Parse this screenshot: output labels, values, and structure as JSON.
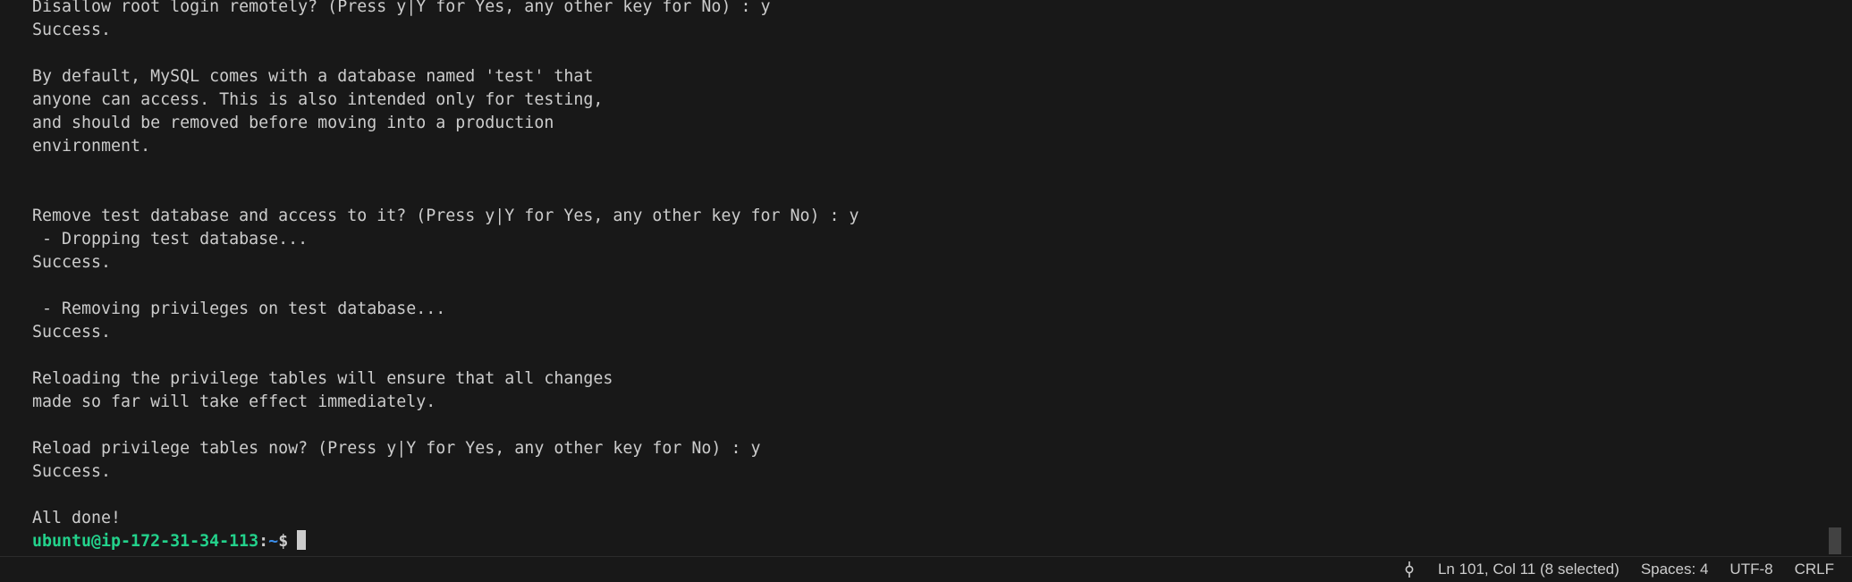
{
  "terminal": {
    "lines": [
      "Disallow root login remotely? (Press y|Y for Yes, any other key for No) : y",
      "Success.",
      "",
      "By default, MySQL comes with a database named 'test' that",
      "anyone can access. This is also intended only for testing,",
      "and should be removed before moving into a production",
      "environment.",
      "",
      "",
      "Remove test database and access to it? (Press y|Y for Yes, any other key for No) : y",
      " - Dropping test database...",
      "Success.",
      "",
      " - Removing privileges on test database...",
      "Success.",
      "",
      "Reloading the privilege tables will ensure that all changes",
      "made so far will take effect immediately.",
      "",
      "Reload privilege tables now? (Press y|Y for Yes, any other key for No) : y",
      "Success.",
      "",
      "All done!"
    ],
    "prompt": {
      "user_host": "ubuntu@ip-172-31-34-113",
      "separator": ":",
      "path": "~",
      "symbol": "$"
    }
  },
  "statusbar": {
    "icon": "source-control-graph-icon",
    "cursor_position": "Ln 101, Col 11 (8 selected)",
    "indentation": "Spaces: 4",
    "encoding": "UTF-8",
    "line_ending": "CRLF"
  },
  "colors": {
    "background": "#181818",
    "text": "#cccccc",
    "prompt_user": "#23d18b",
    "prompt_path": "#3b8eea"
  }
}
